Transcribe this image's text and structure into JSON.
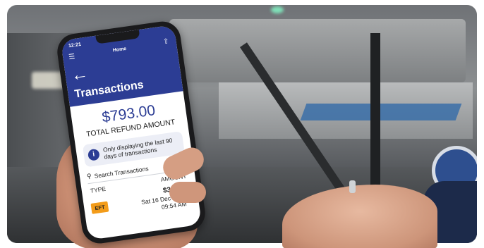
{
  "status": {
    "time": "12:21"
  },
  "header": {
    "home_title": "Home",
    "page_title": "Transactions",
    "menu_icon": "menu-icon",
    "share_icon": "share-icon",
    "back_icon": "back-arrow-icon"
  },
  "summary": {
    "amount": "$793.00",
    "label": "TOTAL REFUND AMOUNT"
  },
  "notice": {
    "text": "Only displaying the last 90 days of transactions"
  },
  "search": {
    "placeholder": "Search Transactions"
  },
  "table": {
    "columns": [
      "TYPE",
      "AMOUNT"
    ],
    "rows": [
      {
        "type": "EFT",
        "amount": "$39.40",
        "date": "Sat 16 Dec 2023",
        "time": "09:54 AM"
      }
    ]
  },
  "colors": {
    "brand_blue": "#2c3d94",
    "badge_orange": "#f39c1a"
  }
}
